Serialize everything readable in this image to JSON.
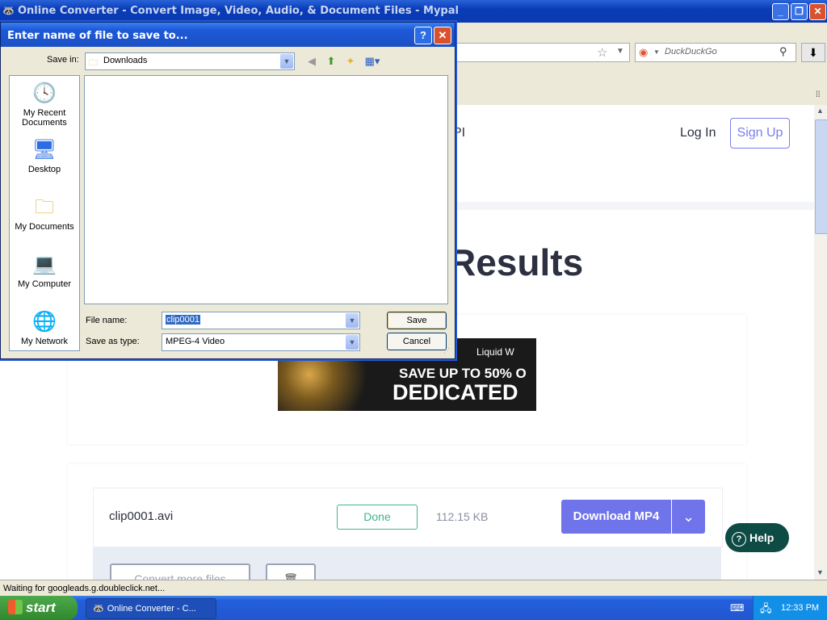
{
  "window": {
    "title": "Online Converter - Convert Image, Video, Audio, & Document Files - Mypal"
  },
  "browser": {
    "search_placeholder": "DuckDuckGo"
  },
  "page": {
    "nav_partial": "PI",
    "login": "Log In",
    "signup": "Sign Up",
    "heading_partial": "Results",
    "ad": {
      "brand": "Liquid W",
      "line1": "SAVE UP TO 50% O",
      "line2": "DEDICATED"
    },
    "file": {
      "name": "clip0001.avi",
      "status": "Done",
      "size": "112.15 KB",
      "download_label": "Download MP4"
    },
    "convert_more": "Convert more files",
    "help": "Help"
  },
  "status_text": "Waiting for googleads.g.doubleclick.net...",
  "taskbar": {
    "start": "start",
    "task": "Online Converter - C...",
    "clock": "12:33 PM"
  },
  "dialog": {
    "title": "Enter name of file to save to...",
    "save_in_label": "Save in:",
    "save_in_value": "Downloads",
    "places": [
      {
        "label": "My Recent Documents",
        "icon": "recent-documents-icon"
      },
      {
        "label": "Desktop",
        "icon": "desktop-icon"
      },
      {
        "label": "My Documents",
        "icon": "my-documents-icon"
      },
      {
        "label": "My Computer",
        "icon": "my-computer-icon"
      },
      {
        "label": "My Network",
        "icon": "my-network-icon"
      }
    ],
    "file_name_label": "File name:",
    "file_name_value": "clip0001",
    "save_type_label": "Save as type:",
    "save_type_value": "MPEG-4 Video",
    "save_button": "Save",
    "cancel_button": "Cancel"
  }
}
